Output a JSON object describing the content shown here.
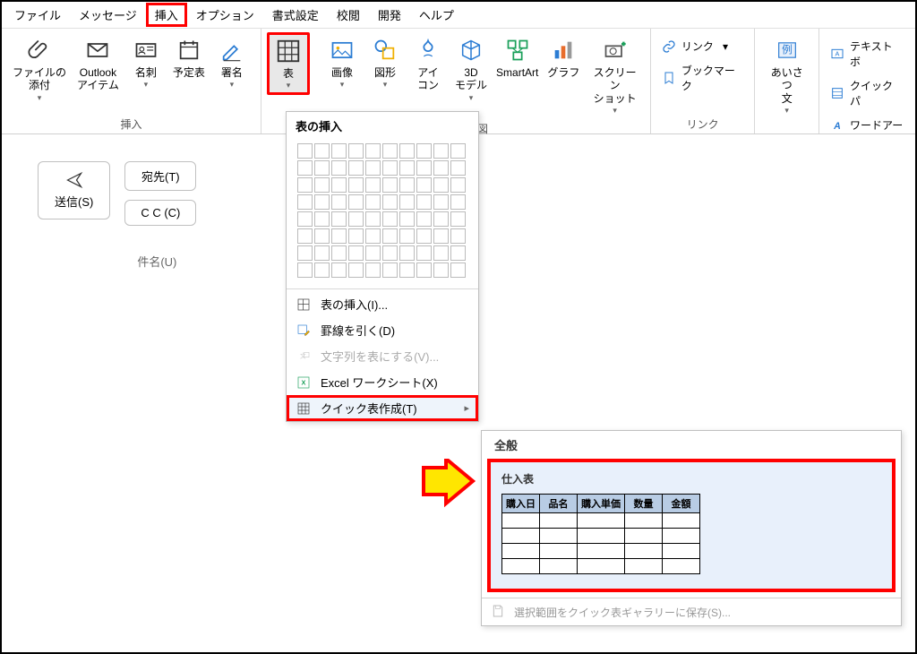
{
  "menubar": {
    "items": [
      "ファイル",
      "メッセージ",
      "挿入",
      "オプション",
      "書式設定",
      "校閲",
      "開発",
      "ヘルプ"
    ],
    "active_index": 2
  },
  "ribbon": {
    "groups": {
      "insert": {
        "label": "挿入",
        "buttons": {
          "attach": "ファイルの\n添付",
          "outlook_item": "Outlook\nアイテム",
          "business_card": "名刺",
          "calendar": "予定表",
          "signature": "署名"
        }
      },
      "table": {
        "button": "表"
      },
      "illustrations": {
        "label": "図",
        "buttons": {
          "picture": "画像",
          "shapes": "図形",
          "icons": "アイ\nコン",
          "model3d": "3D\nモデル",
          "smartart": "SmartArt",
          "chart": "グラフ",
          "screenshot": "スクリーン\nショット"
        }
      },
      "links": {
        "label": "リンク",
        "buttons": {
          "link": "リンク",
          "bookmark": "ブックマーク"
        }
      },
      "greeting": {
        "button": "あいさつ\n文"
      },
      "text": {
        "buttons": {
          "textbox": "テキスト ボ",
          "quickparts": "クイック パ",
          "wordart": "ワードアー"
        }
      }
    }
  },
  "compose": {
    "send": "送信(S)",
    "to": "宛先(T)",
    "cc": "C C (C)",
    "subject": "件名(U)"
  },
  "table_panel": {
    "title": "表の挿入",
    "items": {
      "insert": "表の挿入(I)...",
      "draw": "罫線を引く(D)",
      "convert": "文字列を表にする(V)...",
      "excel": "Excel ワークシート(X)",
      "quick": "クイック表作成(T)"
    }
  },
  "flyout": {
    "header": "全般",
    "preview_title": "仕入表",
    "table_headers": [
      "購入日",
      "品名",
      "購入単価",
      "数量",
      "金額"
    ],
    "footer": "選択範囲をクイック表ギャラリーに保存(S)..."
  }
}
